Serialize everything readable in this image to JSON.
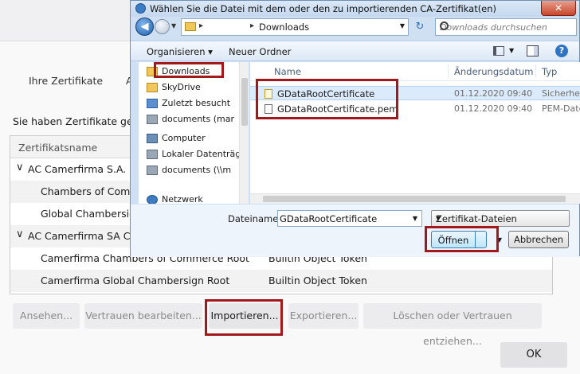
{
  "background": {
    "tabs": [
      "Ihre Zertifikate",
      "A"
    ],
    "description": "Sie haben Zertifikate gesp",
    "table": {
      "header": "Zertifikatsname",
      "rows": [
        {
          "name": "AC Camerfirma S.A.",
          "group": true,
          "token": ""
        },
        {
          "name": "Chambers of Comm",
          "group": false,
          "token": ""
        },
        {
          "name": "Global Chambersig",
          "group": false,
          "token": ""
        },
        {
          "name": "AC Camerfirma SA CIF",
          "group": true,
          "token": ""
        },
        {
          "name": "Camerfirma Chambers of Commerce Root",
          "group": false,
          "token": "Builtin Object Token"
        },
        {
          "name": "Camerfirma Global Chambersign Root",
          "group": false,
          "token": "Builtin Object Token"
        }
      ]
    },
    "buttons": {
      "view": "Ansehen...",
      "edit_trust": "Vertrauen bearbeiten...",
      "import": "Importieren...",
      "export": "Exportieren...",
      "delete": "Löschen oder Vertrauen entziehen...",
      "ok": "OK"
    },
    "chevron": "∨"
  },
  "dialog": {
    "title": "Wählen Sie die Datei mit dem oder den zu importierenden CA-Zertifikat(en)",
    "close": "✕",
    "address": {
      "path": "Downloads",
      "separator": "▸"
    },
    "search_placeholder": "Downloads durchsuchen",
    "toolbar": {
      "organize": "Organisieren ▾",
      "new_folder": "Neuer Ordner"
    },
    "nav": [
      {
        "label": "Downloads",
        "icon": "downloads-folder-icon",
        "color": "#f2c75a"
      },
      {
        "label": "SkyDrive",
        "icon": "folder-icon",
        "color": "#f2c75a"
      },
      {
        "label": "Zuletzt besucht",
        "icon": "recent-icon",
        "color": "#5b8fd1"
      },
      {
        "label": "documents (mar",
        "icon": "network-drive-icon",
        "color": "#9aa7b5"
      },
      {
        "label": "",
        "icon": "",
        "color": ""
      },
      {
        "label": "Computer",
        "icon": "computer-icon",
        "color": "#6c8fb8"
      },
      {
        "label": "Lokaler Datenträg",
        "icon": "drive-icon",
        "color": "#9aa7b5"
      },
      {
        "label": "documents (\\\\m",
        "icon": "network-drive-icon",
        "color": "#9aa7b5"
      },
      {
        "label": "",
        "icon": "",
        "color": ""
      },
      {
        "label": "Netzwerk",
        "icon": "network-icon",
        "color": "#3f7bc1"
      }
    ],
    "columns": {
      "name": "Name",
      "date": "Änderungsdatum",
      "type": "Typ"
    },
    "files": [
      {
        "name": "GDataRootCertificate",
        "date": "01.12.2020 09:40",
        "type": "Sicherheit"
      },
      {
        "name": "GDataRootCertificate.pem",
        "date": "01.12.2020 09:40",
        "type": "PEM-Date"
      }
    ],
    "filename_label": "Dateiname:",
    "filename_value": "GDataRootCertificate",
    "filetype": "Zertifikat-Dateien",
    "open": "Öffnen",
    "cancel": "Abbrechen"
  },
  "colors": {
    "highlight": "#a1191c",
    "selection": "#dcebfc"
  }
}
